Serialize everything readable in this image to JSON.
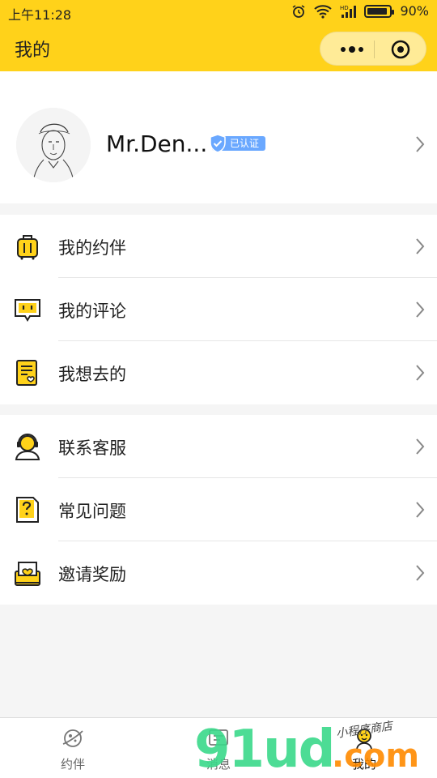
{
  "status_bar": {
    "time": "上午11:28",
    "battery": "90%",
    "battery_level": 0.9
  },
  "nav": {
    "title": "我的"
  },
  "profile": {
    "name": "Mr.Den...",
    "verified_label": "已认证"
  },
  "menu_group_1": [
    {
      "label": "我的约伴",
      "icon": "suitcase-icon"
    },
    {
      "label": "我的评论",
      "icon": "comment-icon"
    },
    {
      "label": "我想去的",
      "icon": "wishlist-icon"
    }
  ],
  "menu_group_2": [
    {
      "label": "联系客服",
      "icon": "customer-service-icon"
    },
    {
      "label": "常见问题",
      "icon": "faq-icon"
    },
    {
      "label": "邀请奖励",
      "icon": "invite-reward-icon"
    }
  ],
  "tabs": [
    {
      "label": "约伴",
      "icon": "planet-icon"
    },
    {
      "label": "消息",
      "icon": "message-icon"
    },
    {
      "label": "我的",
      "icon": "profile-icon",
      "active": true
    }
  ],
  "watermark": {
    "number": "91ud",
    "domain": ".com",
    "tagline": "小程序商店"
  },
  "colors": {
    "brand": "#ffd21a",
    "accent": "#f5c400",
    "verified": "#6aa8ff"
  }
}
